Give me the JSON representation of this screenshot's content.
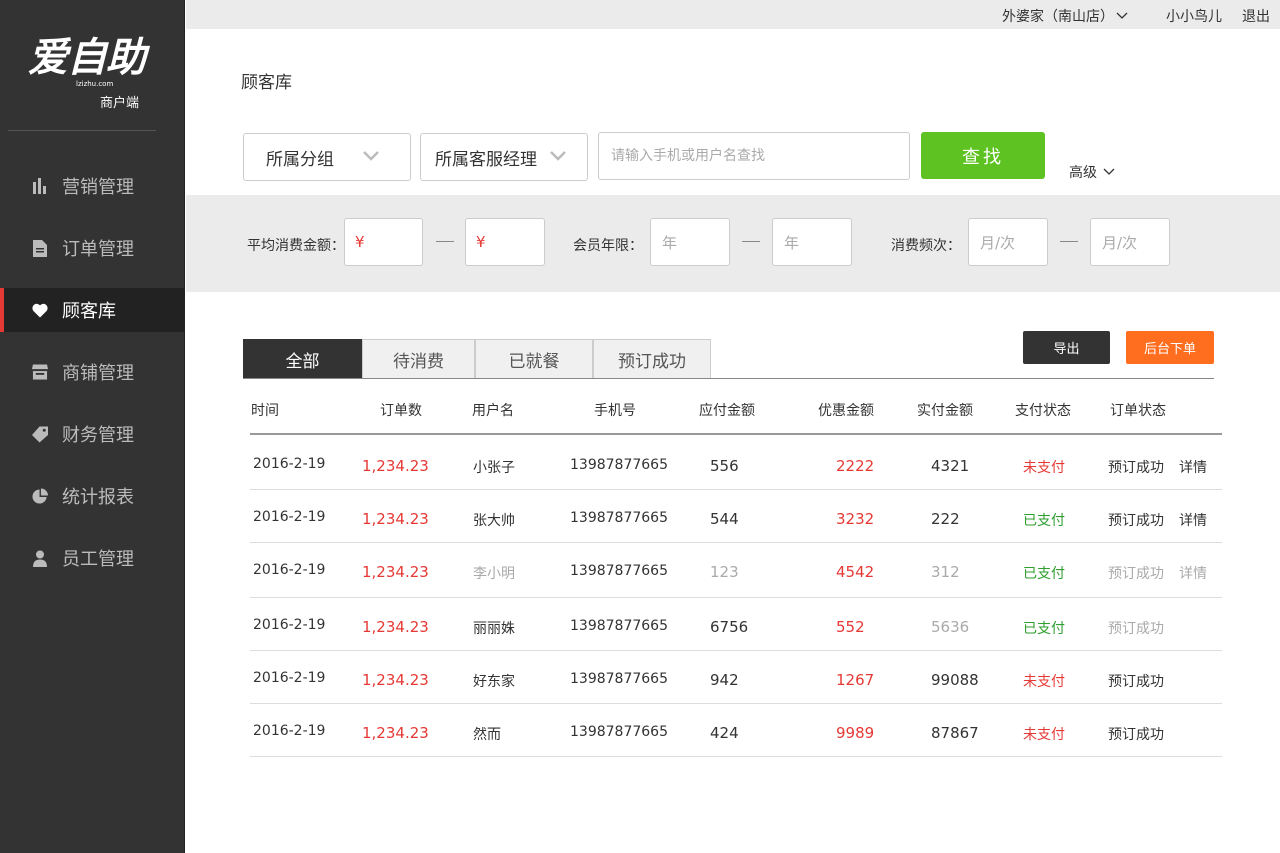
{
  "sidebar": {
    "logo_text": "爱自助",
    "logo_url": "lzizhu.com",
    "logo_sub": "商户端",
    "items": [
      {
        "label": "营销管理",
        "icon": "bar-chart-icon"
      },
      {
        "label": "订单管理",
        "icon": "document-icon"
      },
      {
        "label": "顾客库",
        "icon": "heart-icon"
      },
      {
        "label": "商铺管理",
        "icon": "store-icon"
      },
      {
        "label": "财务管理",
        "icon": "tag-icon"
      },
      {
        "label": "统计报表",
        "icon": "pie-chart-icon"
      },
      {
        "label": "员工管理",
        "icon": "user-icon"
      }
    ],
    "active_index": 2
  },
  "topbar": {
    "store": "外婆家（南山店）",
    "user": "小小鸟儿",
    "logout": "退出"
  },
  "page_title": "顾客库",
  "filters": {
    "group_select": "所属分组",
    "manager_select": "所属客服经理",
    "search_placeholder": "请输入手机或用户名查找",
    "search_button": "查找",
    "advanced": "高级"
  },
  "advanced_filters": {
    "avg_spend_label": "平均消费金额：",
    "currency": "¥",
    "member_years_label": "会员年限：",
    "year_placeholder": "年",
    "frequency_label": "消费频次：",
    "frequency_placeholder": "月/次"
  },
  "tabs": [
    "全部",
    "待消费",
    "已就餐",
    "预订成功"
  ],
  "actions": {
    "export": "导出",
    "backend_order": "后台下单"
  },
  "table": {
    "headers": [
      "时间",
      "订单数",
      "用户名",
      "手机号",
      "应付金额",
      "优惠金额",
      "实付金额",
      "支付状态",
      "订单状态"
    ],
    "detail_label": "详情",
    "rows": [
      {
        "date": "2016-2-19",
        "orders": "1,234.23",
        "user": "小张子",
        "phone": "13987877665",
        "payable": "556",
        "discount": "2222",
        "paid": "4321",
        "pay_status": "未支付",
        "order_status": "预订成功",
        "detail": "详情"
      },
      {
        "date": "2016-2-19",
        "orders": "1,234.23",
        "user": "张大帅",
        "phone": "13987877665",
        "payable": "544",
        "discount": "3232",
        "paid": "222",
        "pay_status": "已支付",
        "order_status": "预订成功",
        "detail": "详情"
      },
      {
        "date": "2016-2-19",
        "orders": "1,234.23",
        "user": "李小明",
        "phone": "13987877665",
        "payable": "123",
        "discount": "4542",
        "paid": "312",
        "pay_status": "已支付",
        "order_status": "预订成功",
        "detail": "详情"
      },
      {
        "date": "2016-2-19",
        "orders": "1,234.23",
        "user": "丽丽姝",
        "phone": "13987877665",
        "payable": "6756",
        "discount": "552",
        "paid": "5636",
        "pay_status": "已支付",
        "order_status": "预订成功",
        "detail": ""
      },
      {
        "date": "2016-2-19",
        "orders": "1,234.23",
        "user": "好东家",
        "phone": "13987877665",
        "payable": "942",
        "discount": "1267",
        "paid": "99088",
        "pay_status": "未支付",
        "order_status": "预订成功",
        "detail": ""
      },
      {
        "date": "2016-2-19",
        "orders": "1,234.23",
        "user": "然而",
        "phone": "13987877665",
        "payable": "424",
        "discount": "9989",
        "paid": "87867",
        "pay_status": "未支付",
        "order_status": "预订成功",
        "detail": ""
      }
    ]
  },
  "colors": {
    "accent_red": "#e53935",
    "accent_green": "#5ec322",
    "accent_orange": "#ff6d1f",
    "sidebar_bg": "#333333"
  }
}
